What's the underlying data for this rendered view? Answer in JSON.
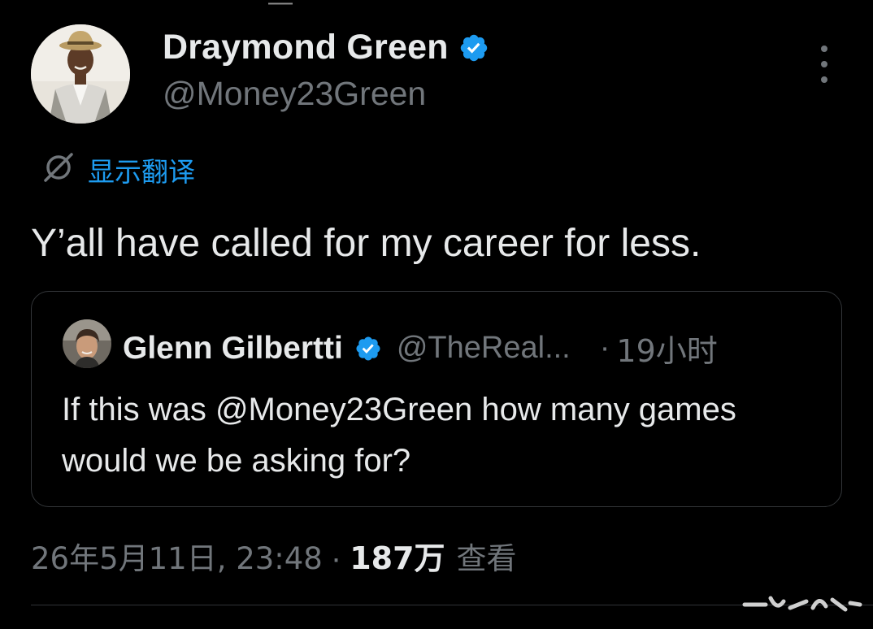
{
  "tweet": {
    "author": {
      "name": "Draymond Green",
      "handle": "@Money23Green",
      "verified": true
    },
    "translate_label": "显示翻译",
    "text": "Y’all have called for my career for less.",
    "quote": {
      "name": "Glenn Gilbertti",
      "handle": "@TheReal...",
      "separator": "·",
      "time": "19小时",
      "text": "If this was @Money23Green how many games would we be asking for?"
    },
    "meta": {
      "datetime": "26年5月11日, 23:48",
      "separator": "·",
      "views_count": "187万",
      "views_label": "查看"
    }
  },
  "icons": {
    "verified": "verified-badge-icon",
    "translate": "translate-icon",
    "more": "more-options-icon"
  },
  "colors": {
    "background": "#000000",
    "text": "#e7e9ea",
    "secondary": "#71767b",
    "accent": "#1d9bf0",
    "border": "#333639"
  }
}
